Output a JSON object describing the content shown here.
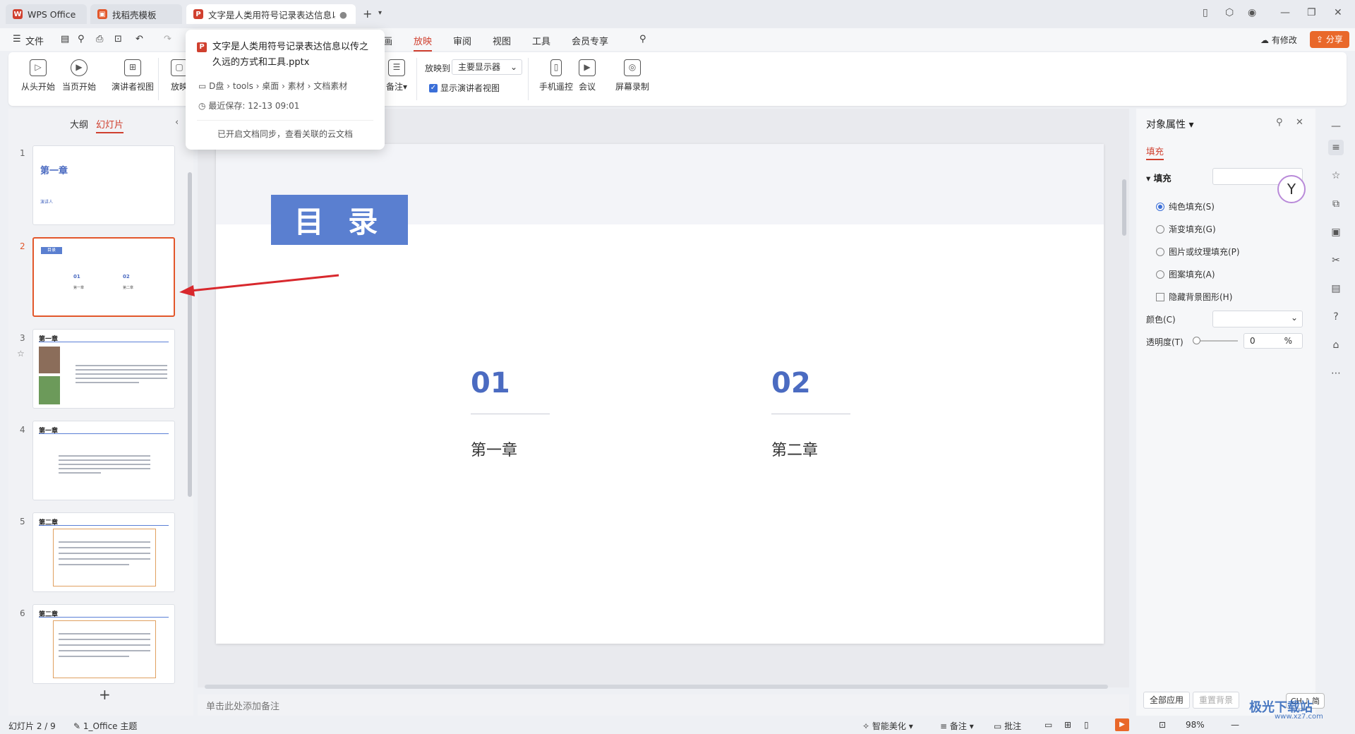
{
  "titlebar": {
    "tabs": [
      {
        "label": "WPS Office",
        "icon": "wps-logo-icon"
      },
      {
        "label": "找稻壳模板",
        "icon": "docer-icon"
      },
      {
        "label": "文字是人类用符号记录表达信息以",
        "icon": "ppt-file-icon"
      }
    ],
    "new_tab": "+",
    "colors": {
      "brand_red": "#d0402f",
      "selected": "#e2572b"
    }
  },
  "menubar": {
    "file": "文件",
    "items": [
      "画",
      "放映",
      "审阅",
      "视图",
      "工具",
      "会员专享"
    ],
    "active": "放映",
    "revise": "有修改",
    "share": "分享"
  },
  "ribbon": {
    "buttons": [
      "从头开始",
      "当页开始",
      "演讲者视图",
      "放映"
    ],
    "notes_btn": "备注",
    "play_to_label": "放映到",
    "display_select": "主要显示器",
    "presenter_view_check": "显示演讲者视图",
    "right_buttons": [
      "手机遥控",
      "会议",
      "屏幕录制"
    ]
  },
  "popup": {
    "filename": "文字是人类用符号记录表达信息以传之久远的方式和工具.pptx",
    "path": [
      "D盘",
      "tools",
      "桌面",
      "素材",
      "文档素材"
    ],
    "last_saved": "最近保存: 12-13 09:01",
    "footer": "已开启文档同步，查看关联的云文档"
  },
  "leftpanel": {
    "tabs": [
      "大纲",
      "幻灯片"
    ],
    "active_tab": "幻灯片",
    "thumbnails": [
      {
        "num": "1",
        "title": "第一章",
        "sub": "演讲人"
      },
      {
        "num": "2",
        "title": "目录",
        "items": [
          "01",
          "02"
        ],
        "labels": [
          "第一章",
          "第二章"
        ]
      },
      {
        "num": "3",
        "title": "第一章"
      },
      {
        "num": "4",
        "title": "第一章"
      },
      {
        "num": "5",
        "title": "第二章"
      },
      {
        "num": "6",
        "title": "第二章"
      }
    ],
    "add": "+"
  },
  "slide": {
    "toc_title": "目 录",
    "items": [
      {
        "num": "01",
        "label": "第一章"
      },
      {
        "num": "02",
        "label": "第二章"
      }
    ]
  },
  "notes": {
    "placeholder": "单击此处添加备注"
  },
  "rightpanel": {
    "title": "对象属性",
    "tab": "填充",
    "section": "填充",
    "options": [
      {
        "label": "纯色填充(S)",
        "type": "radio",
        "selected": true
      },
      {
        "label": "渐变填充(G)",
        "type": "radio",
        "selected": false
      },
      {
        "label": "图片或纹理填充(P)",
        "type": "radio",
        "selected": false
      },
      {
        "label": "图案填充(A)",
        "type": "radio",
        "selected": false
      },
      {
        "label": "隐藏背景图形(H)",
        "type": "checkbox",
        "selected": false
      }
    ],
    "color_label": "颜色(C)",
    "transparency_label": "透明度(T)",
    "transparency_value": "0",
    "transparency_unit": "%",
    "apply_all": "全部应用",
    "reset_bg": "重置背景"
  },
  "statusbar": {
    "slide_info": "幻灯片 2 / 9",
    "theme": "1_Office 主题",
    "beautify": "智能美化",
    "notes": "备注",
    "comments": "批注",
    "zoom": "98%",
    "ime": "CH ♪ 简"
  },
  "watermark": {
    "text": "极光下载站",
    "url": "www.xz7.com"
  }
}
